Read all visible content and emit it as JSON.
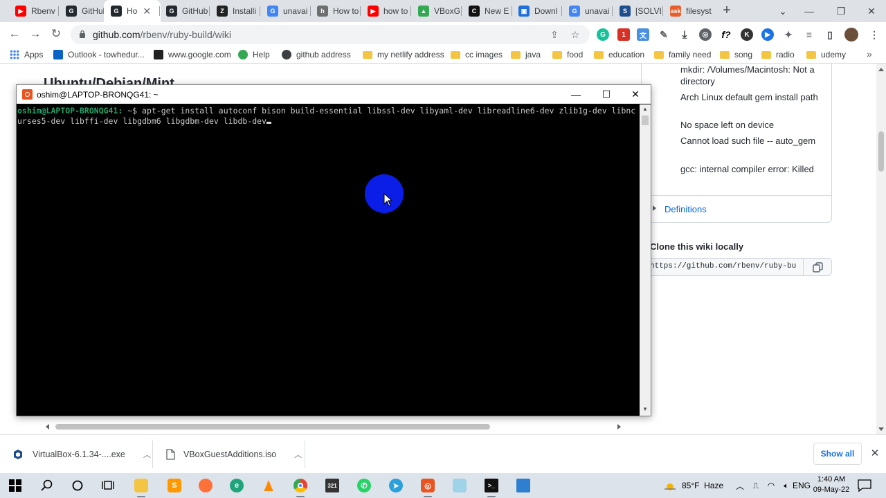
{
  "browser": {
    "tabs": [
      {
        "label": "Rbenv",
        "fav_color": "#ff0000",
        "fav_text": "▶"
      },
      {
        "label": "GitHub",
        "fav_color": "#24292f",
        "fav_text": "G"
      },
      {
        "label": "Ho",
        "fav_color": "#24292f",
        "fav_text": "G",
        "active": true
      },
      {
        "label": "GitHub",
        "fav_color": "#24292f",
        "fav_text": "G"
      },
      {
        "label": "Installi",
        "fav_color": "#222222",
        "fav_text": "Z"
      },
      {
        "label": "unavai",
        "fav_color": "#4285f4",
        "fav_text": "G"
      },
      {
        "label": "How to",
        "fav_color": "#6e6e6e",
        "fav_text": "h"
      },
      {
        "label": "how to",
        "fav_color": "#ff0000",
        "fav_text": "▶"
      },
      {
        "label": "VBoxG",
        "fav_color": "#34a853",
        "fav_text": "▲"
      },
      {
        "label": "New E",
        "fav_color": "#111111",
        "fav_text": "C"
      },
      {
        "label": "Downl",
        "fav_color": "#1e6fd9",
        "fav_text": "▣"
      },
      {
        "label": "unavai",
        "fav_color": "#4285f4",
        "fav_text": "G"
      },
      {
        "label": "[SOLVE",
        "fav_color": "#1f4e8c",
        "fav_text": "S"
      },
      {
        "label": "filesyst",
        "fav_color": "#e85d2a",
        "fav_text": "ask"
      }
    ],
    "url_host": "github.com",
    "url_path": "/rbenv/ruby-build/wiki",
    "bookmarks": [
      {
        "label": "Apps",
        "type": "apps"
      },
      {
        "label": "Outlook - towhedur...",
        "type": "outlook"
      },
      {
        "label": "www.google.com",
        "type": "site"
      },
      {
        "label": "Help",
        "type": "help"
      },
      {
        "label": "github address",
        "type": "github"
      },
      {
        "label": "my netlify address",
        "type": "folder"
      },
      {
        "label": "cc images",
        "type": "folder"
      },
      {
        "label": "java",
        "type": "folder"
      },
      {
        "label": "food",
        "type": "folder"
      },
      {
        "label": "education",
        "type": "folder"
      },
      {
        "label": "family need",
        "type": "folder"
      },
      {
        "label": "song",
        "type": "folder"
      },
      {
        "label": "radio",
        "type": "folder"
      },
      {
        "label": "udemy",
        "type": "folder"
      }
    ]
  },
  "page": {
    "heading": "Ubuntu/Debian/Mint",
    "sidebar_links": [
      "mkdir: /Volumes/Macintosh: Not a directory",
      "Arch Linux default gem install path",
      "No space left on device",
      "Cannot load such file -- auto_gem",
      "gcc: internal compiler error: Killed"
    ],
    "definitions": "Definitions",
    "clone_title": "Clone this wiki locally",
    "clone_url": "https://github.com/rbenv/ruby-build.wiki.git"
  },
  "terminal": {
    "title": "oshim@LAPTOP-BRONQG41: ~",
    "prompt": "oshim@LAPTOP-BRONQG41:",
    "path": " ~$ ",
    "command": "apt-get install autoconf bison build-essential libssl-dev libyaml-dev libreadline6-dev zlib1g-dev libncurses5-dev libffi-dev libgdbm6 libgdbm-dev libdb-dev"
  },
  "downloads": {
    "items": [
      {
        "name": "VirtualBox-6.1.34-....exe"
      },
      {
        "name": "VBoxGuestAdditions.iso"
      }
    ],
    "show_all": "Show all"
  },
  "taskbar": {
    "weather_temp": "85°F",
    "weather_text": "Haze",
    "time": "1:40 AM",
    "date": "09-May-22"
  },
  "colors": {
    "accent": "#1a73e8",
    "terminal_prompt": "#26a269",
    "ubuntu_orange": "#e95420",
    "click_indicator": "#0b1ee8"
  }
}
